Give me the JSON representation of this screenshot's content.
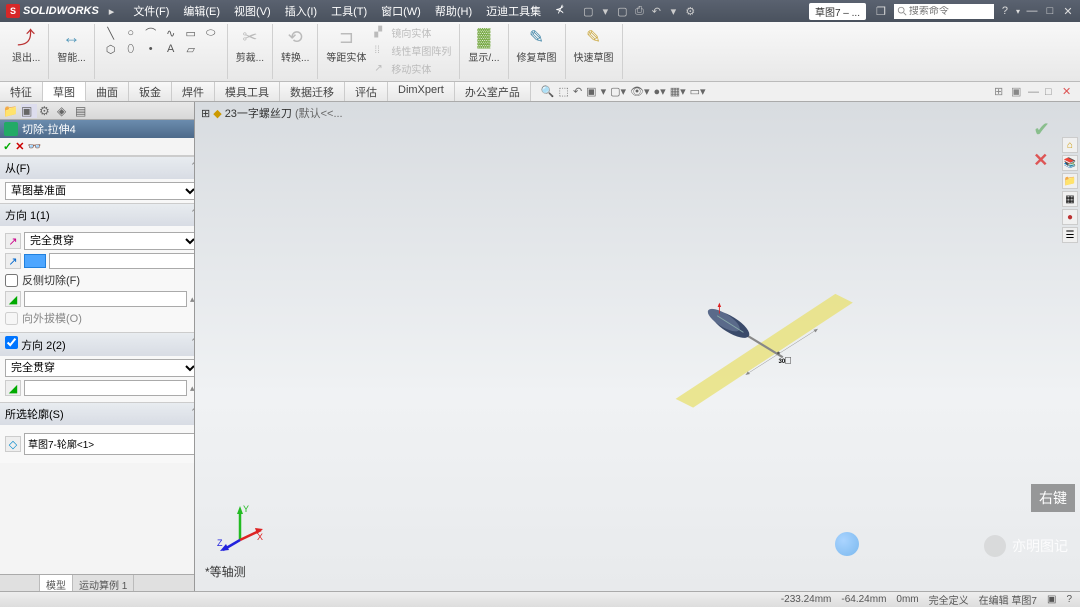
{
  "app": {
    "name": "SOLIDWORKS"
  },
  "menu": {
    "file": "文件(F)",
    "edit": "编辑(E)",
    "view": "视图(V)",
    "insert": "插入(I)",
    "tools": "工具(T)",
    "window": "窗口(W)",
    "help": "帮助(H)",
    "maidi": "迈迪工具集"
  },
  "title_tab": "草图7 – ...",
  "search_placeholder": "搜索命令",
  "ribbon": {
    "exit": "退出...",
    "smart": "智能...",
    "trim": "剪裁...",
    "convert": "转换...",
    "offset": "等距实体",
    "mirror": "镜向实体",
    "linear_pattern": "线性草图阵列",
    "move": "移动实体",
    "display": "显示/...",
    "repair": "修复草图",
    "quick": "快速草图"
  },
  "tabs": {
    "feature": "特征",
    "sketch": "草图",
    "surface": "曲面",
    "sheet": "钣金",
    "weld": "焊件",
    "mold": "模具工具",
    "data": "数据迁移",
    "eval": "评估",
    "dimxpert": "DimXpert",
    "office": "办公室产品"
  },
  "pm": {
    "title": "切除-拉伸4",
    "from_header": "从(F)",
    "from_value": "草图基准面",
    "dir1_header": "方向 1(1)",
    "dir1_end": "完全贯穿",
    "reverse_cut": "反侧切除(F)",
    "outward_draft": "向外拔模(O)",
    "dir2_header": "方向 2(2)",
    "dir2_end": "完全贯穿",
    "contours_header": "所选轮廓(S)",
    "contour_item": "草图7-轮廓<1>"
  },
  "left_tabs": {
    "model": "模型",
    "motion": "运动算例 1"
  },
  "breadcrumb": {
    "part": "23一字螺丝刀",
    "state": "(默认<<..."
  },
  "dimension_label": "30",
  "view_name": "*等轴测",
  "status": {
    "x": "-233.24mm",
    "y": "-64.24mm",
    "z": "0mm",
    "defined": "完全定义",
    "editing": "在编辑 草图7"
  },
  "watermark": {
    "right": "亦明图记",
    "box": "右键"
  }
}
